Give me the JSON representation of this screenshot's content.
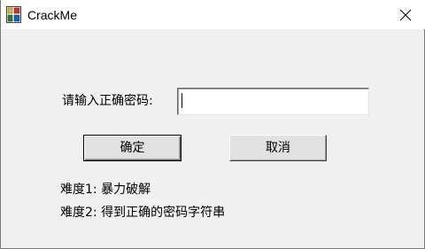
{
  "window": {
    "title": "CrackMe",
    "icon": "mfc-app-icon",
    "close_icon": "close-icon"
  },
  "form": {
    "password_label": "请输入正确密码:",
    "password_value": "",
    "ok_label": "确定",
    "cancel_label": "取消"
  },
  "info": {
    "difficulty_1": "难度1: 暴力破解",
    "difficulty_2": "难度2: 得到正确的密码字符串"
  },
  "colors": {
    "dialog_bg": "#f0f0f0",
    "titlebar_bg": "#ffffff",
    "button_bg": "#e1e1e1"
  }
}
